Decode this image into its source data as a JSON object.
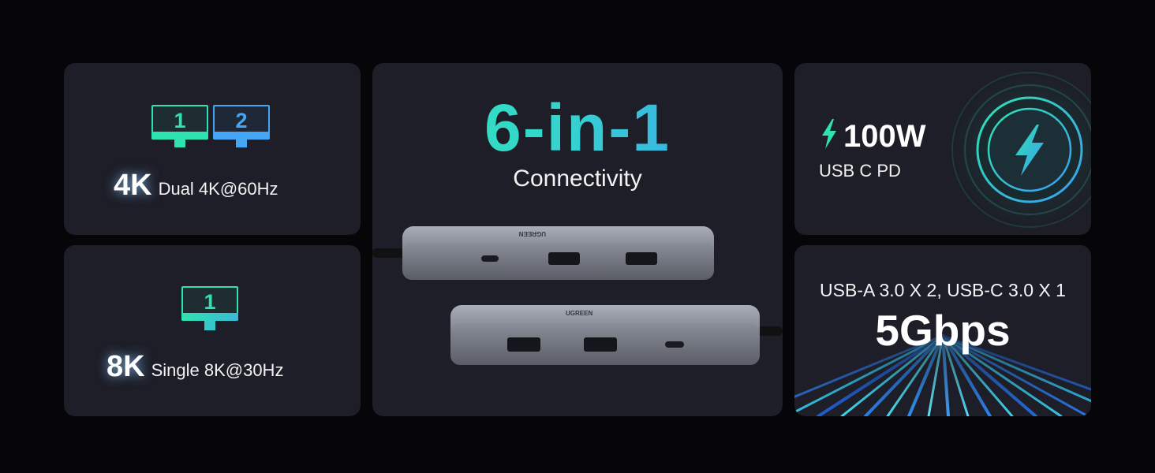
{
  "dual_card": {
    "monitor_1": "1",
    "monitor_2": "2",
    "resolution": "4K",
    "description": "Dual 4K@60Hz"
  },
  "single_card": {
    "monitor_1": "1",
    "resolution": "8K",
    "description": "Single 8K@30Hz"
  },
  "center_card": {
    "headline": "6-in-1",
    "subtitle": "Connectivity",
    "brand_top": "UGREEN",
    "brand_bottom": "UGREEN"
  },
  "power_card": {
    "wattage": "100W",
    "description": "USB C PD",
    "icon": "lightning-bolt-icon"
  },
  "speed_card": {
    "ports": "USB-A 3.0 X 2, USB-C 3.0 X 1",
    "speed": "5Gbps"
  },
  "colors": {
    "background": "#060608",
    "card": "#1d1e27",
    "accent_green": "#2fe6b2",
    "accent_blue": "#3c9cf2"
  }
}
